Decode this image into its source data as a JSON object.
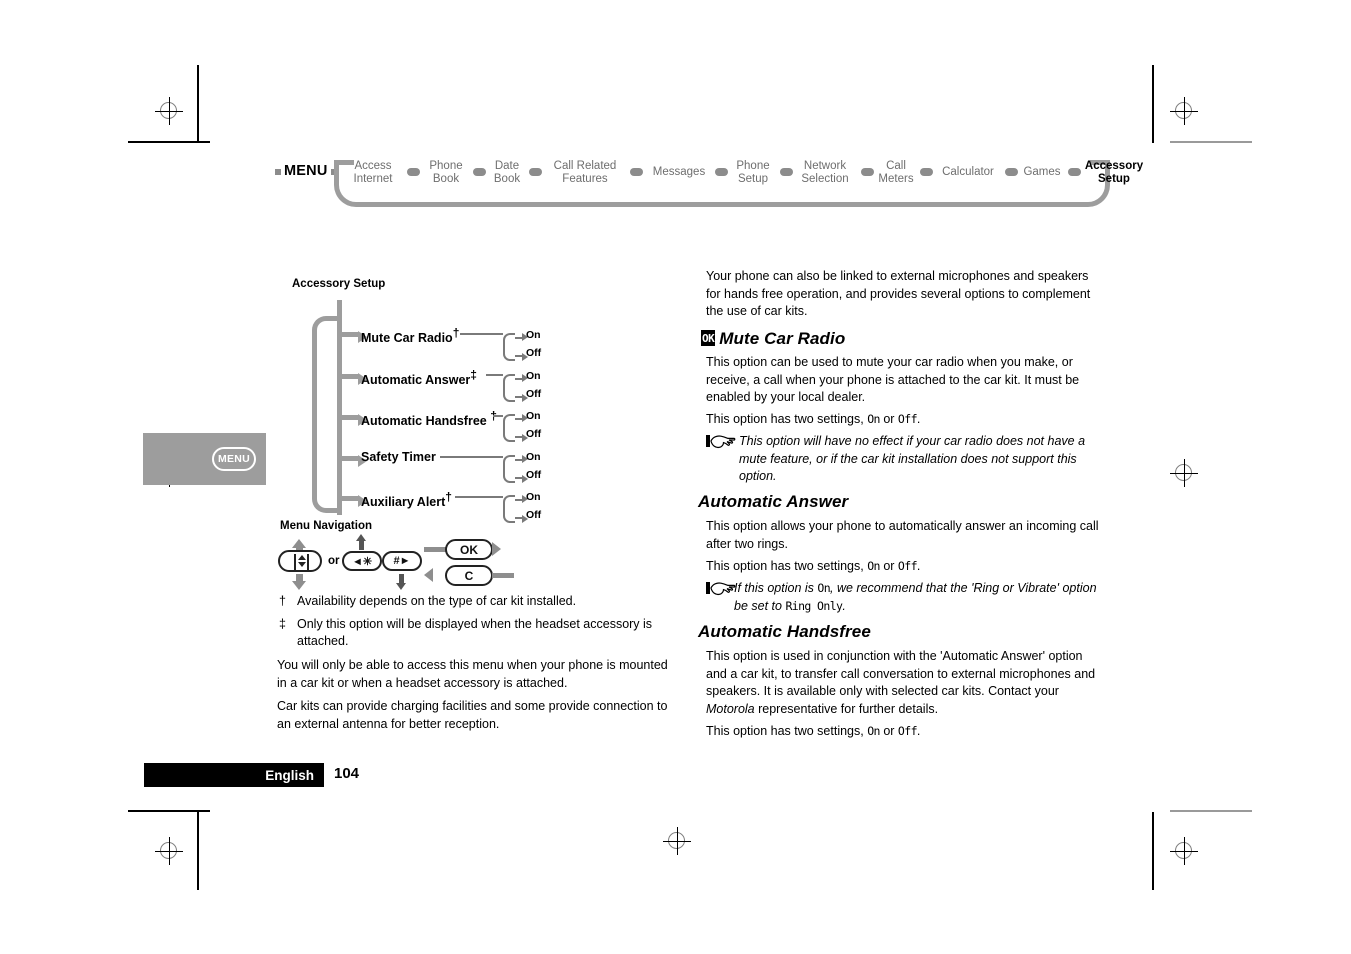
{
  "menu_bar": {
    "label": "MENU",
    "items": [
      {
        "label": "Access\nInternet",
        "active": false
      },
      {
        "label": "Phone\nBook",
        "active": false
      },
      {
        "label": "Date\nBook",
        "active": false
      },
      {
        "label": "Call Related\nFeatures",
        "active": false
      },
      {
        "label": "Messages",
        "active": false
      },
      {
        "label": "Phone\nSetup",
        "active": false
      },
      {
        "label": "Network\nSelection",
        "active": false
      },
      {
        "label": "Call\nMeters",
        "active": false
      },
      {
        "label": "Calculator",
        "active": false
      },
      {
        "label": "Games",
        "active": false
      },
      {
        "label": "Accessory\nSetup",
        "active": true
      }
    ]
  },
  "tab": {
    "key_label": "MENU"
  },
  "tree": {
    "title": "Accessory Setup",
    "nav_title": "Menu Navigation",
    "nodes": [
      {
        "label": "Mute Car Radio",
        "dagger": "†",
        "options": [
          "On",
          "Off"
        ]
      },
      {
        "label": "Automatic Answer",
        "dagger": "‡",
        "options": [
          "On",
          "Off"
        ]
      },
      {
        "label": "Automatic Handsfree",
        "dagger": "†",
        "options": [
          "On",
          "Off"
        ]
      },
      {
        "label": "Safety Timer",
        "dagger": "",
        "options": [
          "On",
          "Off"
        ]
      },
      {
        "label": "Auxiliary Alert",
        "dagger": "†",
        "options": [
          "On",
          "Off"
        ]
      }
    ]
  },
  "nav_keys": {
    "or_label": "or",
    "star_key": "◄✳",
    "hash_key": "#►",
    "ok_key": "OK",
    "c_key": "C"
  },
  "footnotes": [
    {
      "mark": "†",
      "text": "Availability depends on the type of car kit installed."
    },
    {
      "mark": "‡",
      "text": "Only this option will be displayed when the headset accessory is attached."
    }
  ],
  "left_paragraphs": [
    "You will only be able to access this menu when your phone is mounted in a car kit or when a headset accessory is attached.",
    "Car kits can provide charging facilities and some provide connection to an external antenna for better reception."
  ],
  "right_column": {
    "intro": "Your phone can also be linked to external microphones and speakers for hands free operation, and provides several options to complement the use of car kits.",
    "sections": [
      {
        "badge": "OK",
        "heading": "Mute Car Radio",
        "body": "This option can be used to mute your car radio when you make, or receive, a call when your phone is attached to the car kit. It must be enabled by your local dealer.",
        "settings_prefix": "This option has two settings, ",
        "settings_on": "On",
        "settings_mid": " or ",
        "settings_off": "Off",
        "settings_suffix": ".",
        "note": "This option will have no effect if your car radio does not have a mute feature, or if the car kit installation does not support this option."
      },
      {
        "badge": "",
        "heading": "Automatic Answer",
        "body": "This option allows your phone to automatically answer an incoming call after two rings.",
        "settings_prefix": "This option has two settings, ",
        "settings_on": "On",
        "settings_mid": " or ",
        "settings_off": "Off",
        "settings_suffix": ".",
        "note_a": "If this option is ",
        "note_lcd1": "On",
        "note_b": ", we recommend that the 'Ring or Vibrate' option be set to ",
        "note_lcd2": "Ring Only",
        "note_c": "."
      },
      {
        "badge": "",
        "heading": "Automatic Handsfree",
        "body_a": "This option is used in conjunction with the 'Automatic Answer' option and a car kit, to transfer call conversation to external microphones and speakers. It is available only with selected car kits. Contact your ",
        "body_italic": "Motorola",
        "body_b": " representative for further details.",
        "settings_prefix": "This option has two settings, ",
        "settings_on": "On",
        "settings_mid": " or ",
        "settings_off": "Off",
        "settings_suffix": "."
      }
    ]
  },
  "footer": {
    "language": "English",
    "page_number": "104"
  },
  "colors": {
    "gray_rule": "#9d9d9d",
    "tree_gray": "#9d9d9d",
    "sub_gray": "#7a7a7a",
    "black": "#000000"
  }
}
